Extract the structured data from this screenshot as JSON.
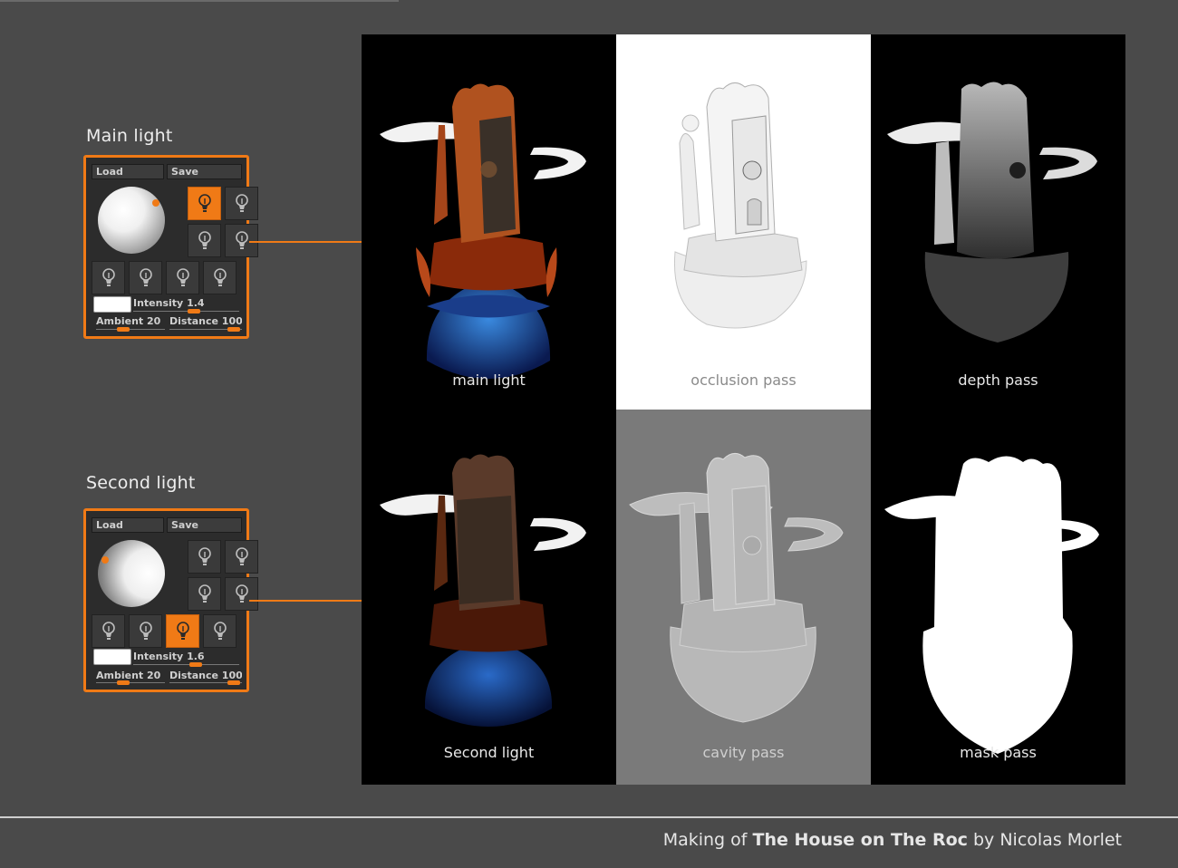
{
  "panels": [
    {
      "title": "Main light",
      "load_label": "Load",
      "save_label": "Save",
      "intensity_label": "Intensity",
      "intensity_value": "1.4",
      "ambient_label": "Ambient",
      "ambient_value": "20",
      "distance_label": "Distance",
      "distance_value": "100",
      "active_bulb": 0
    },
    {
      "title": "Second light",
      "load_label": "Load",
      "save_label": "Save",
      "intensity_label": "Intensity",
      "intensity_value": "1.6",
      "ambient_label": "Ambient",
      "ambient_value": "20",
      "distance_label": "Distance",
      "distance_value": "100",
      "active_bulb": 6
    }
  ],
  "passes": [
    {
      "label": "main light",
      "background": "#000000",
      "text_color": "#e8e8e8"
    },
    {
      "label": "occlusion pass",
      "background": "#ffffff",
      "text_color": "#8a8a8a"
    },
    {
      "label": "depth pass",
      "background": "#000000",
      "text_color": "#e8e8e8"
    },
    {
      "label": "Second light",
      "background": "#000000",
      "text_color": "#e8e8e8"
    },
    {
      "label": "cavity pass",
      "background": "#7a7a7a",
      "text_color": "#cfcfcf"
    },
    {
      "label": "mask pass",
      "background": "#000000",
      "text_color": "#e8e8e8"
    }
  ],
  "caption": {
    "prefix": "Making of",
    "title": "The House on The Roc",
    "suffix": "by Nicolas Morlet"
  },
  "colors": {
    "accent": "#f07a16",
    "background": "#4a4a4a"
  }
}
